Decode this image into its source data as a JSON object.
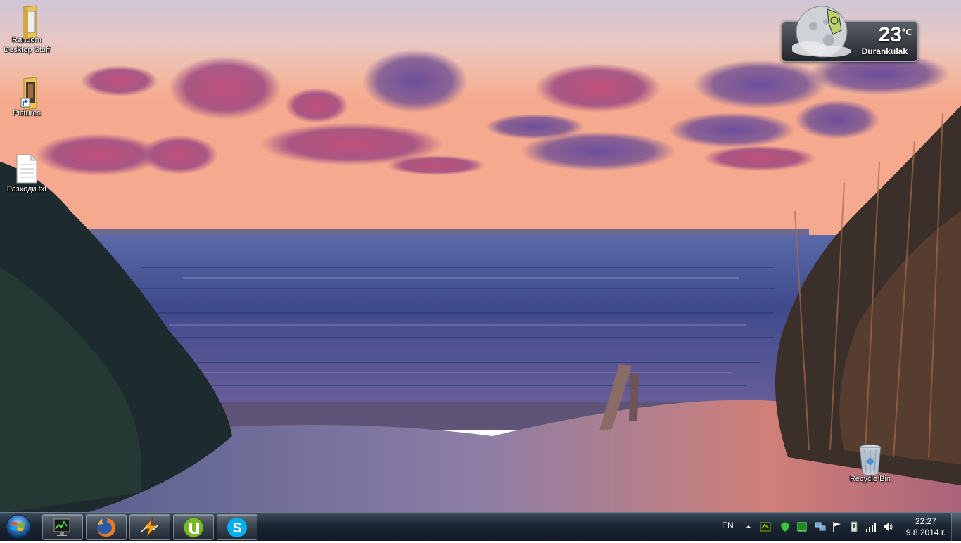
{
  "desktop": {
    "icons": [
      {
        "label": "Random\nDesktop Stuff",
        "icon": "folder-icon"
      },
      {
        "label": "Pictures",
        "icon": "folder-shortcut-icon"
      },
      {
        "label": "Разходи.txt",
        "icon": "text-file-icon"
      },
      {
        "label": "Recycle Bin",
        "icon": "recycle-bin-icon"
      }
    ]
  },
  "weather_gadget": {
    "temperature": "23",
    "unit": "°C",
    "location": "Durankulak",
    "condition_icon": "moon-cloud-icon"
  },
  "taskbar": {
    "start_icon": "windows-start-icon",
    "pinned": [
      {
        "name": "task-manager",
        "icon": "monitor-graph-icon"
      },
      {
        "name": "firefox",
        "icon": "firefox-icon"
      },
      {
        "name": "winamp",
        "icon": "winamp-icon"
      },
      {
        "name": "utorrent",
        "icon": "utorrent-icon"
      },
      {
        "name": "skype",
        "icon": "skype-icon"
      }
    ],
    "tray": {
      "language": "EN",
      "icons": [
        "show-hidden-icon",
        "nvidia-icon",
        "shield-icon",
        "green-square-icon",
        "network-devices-icon",
        "action-center-flag-icon",
        "removable-device-icon",
        "signal-bars-icon",
        "volume-icon"
      ],
      "time": "22:27",
      "date": "9.8.2014 г."
    }
  },
  "colors": {
    "taskbar_top": "#3d4d5e",
    "taskbar_bottom": "#121b26",
    "gadget_bg": "#23262b"
  }
}
